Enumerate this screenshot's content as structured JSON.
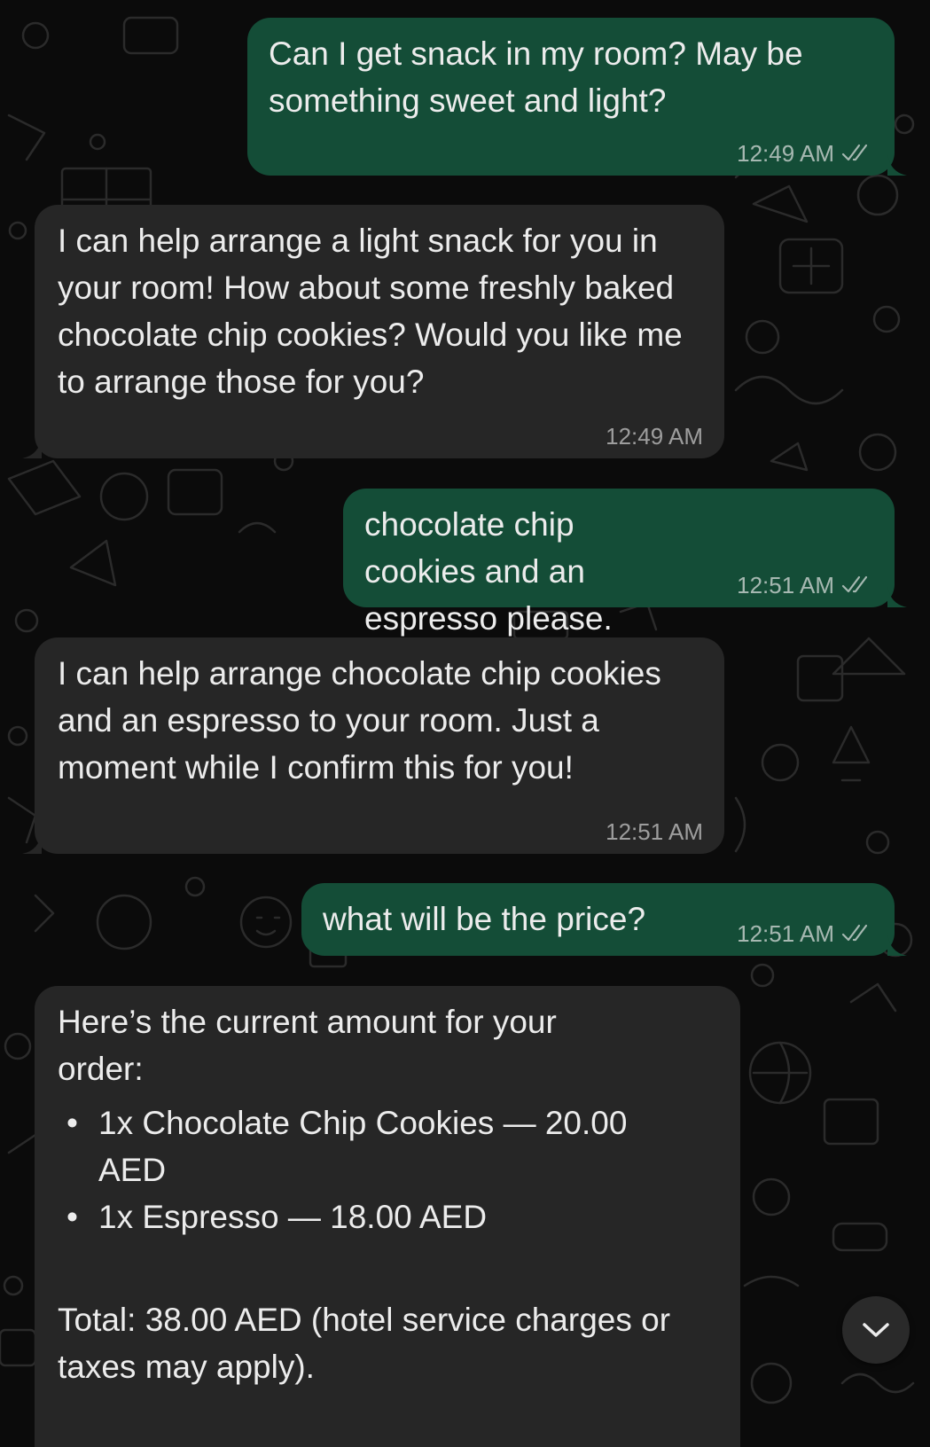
{
  "messages": [
    {
      "direction": "outgoing",
      "text": "Can I get snack in my room? May be something sweet and light?",
      "time": "12:49 AM",
      "status": "read"
    },
    {
      "direction": "incoming",
      "text": "I can help arrange a light snack for you in your room! How about some freshly baked chocolate chip cookies? Would you like me to arrange those for you?",
      "time": "12:49 AM"
    },
    {
      "direction": "outgoing",
      "text": "chocolate chip cookies and an espresso please.",
      "time": "12:51 AM",
      "status": "read"
    },
    {
      "direction": "incoming",
      "text": "I can help arrange chocolate chip cookies and an espresso to your room. Just a moment while I confirm this for you!",
      "time": "12:51 AM"
    },
    {
      "direction": "outgoing",
      "text": "what will be the price?",
      "time": "12:51 AM",
      "status": "read"
    },
    {
      "direction": "incoming",
      "intro": "Here’s the current amount for your order:",
      "items": [
        "1x Chocolate Chip Cookies — 20.00 AED",
        "1x Espresso — 18.00 AED"
      ],
      "total": "Total: 38.00 AED (hotel service charges or taxes may apply)."
    }
  ],
  "scroll_button": {
    "icon": "chevron-down-icon"
  },
  "colors": {
    "outgoing_bubble": "#144d37",
    "incoming_bubble": "#262626",
    "background": "#0b0b0b",
    "text": "#ececec"
  }
}
